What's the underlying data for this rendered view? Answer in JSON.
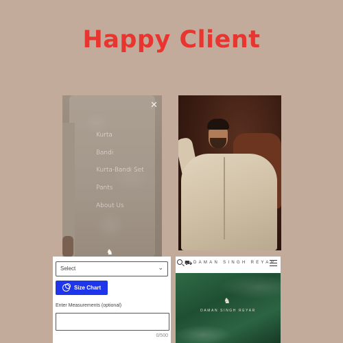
{
  "headline": "Happy Client",
  "menu_panel": {
    "close_icon": "close-icon",
    "items": [
      "Kurta",
      "Bandi",
      "Kurta-Bandi Set",
      "Pants",
      "About Us"
    ]
  },
  "form_panel": {
    "select_value": "Select",
    "size_chart_label": "Size Chart",
    "measurements_label": "Enter Measurements (optional)",
    "counter": "0/500"
  },
  "site_panel": {
    "brand": "DAMAN SINGH REYAR",
    "banner_brand": "DAMAN SINGH REYAR"
  },
  "colors": {
    "background": "#c2ab9a",
    "headline": "#e8352f",
    "button": "#1f35ea",
    "silk": "#1f4f33"
  }
}
